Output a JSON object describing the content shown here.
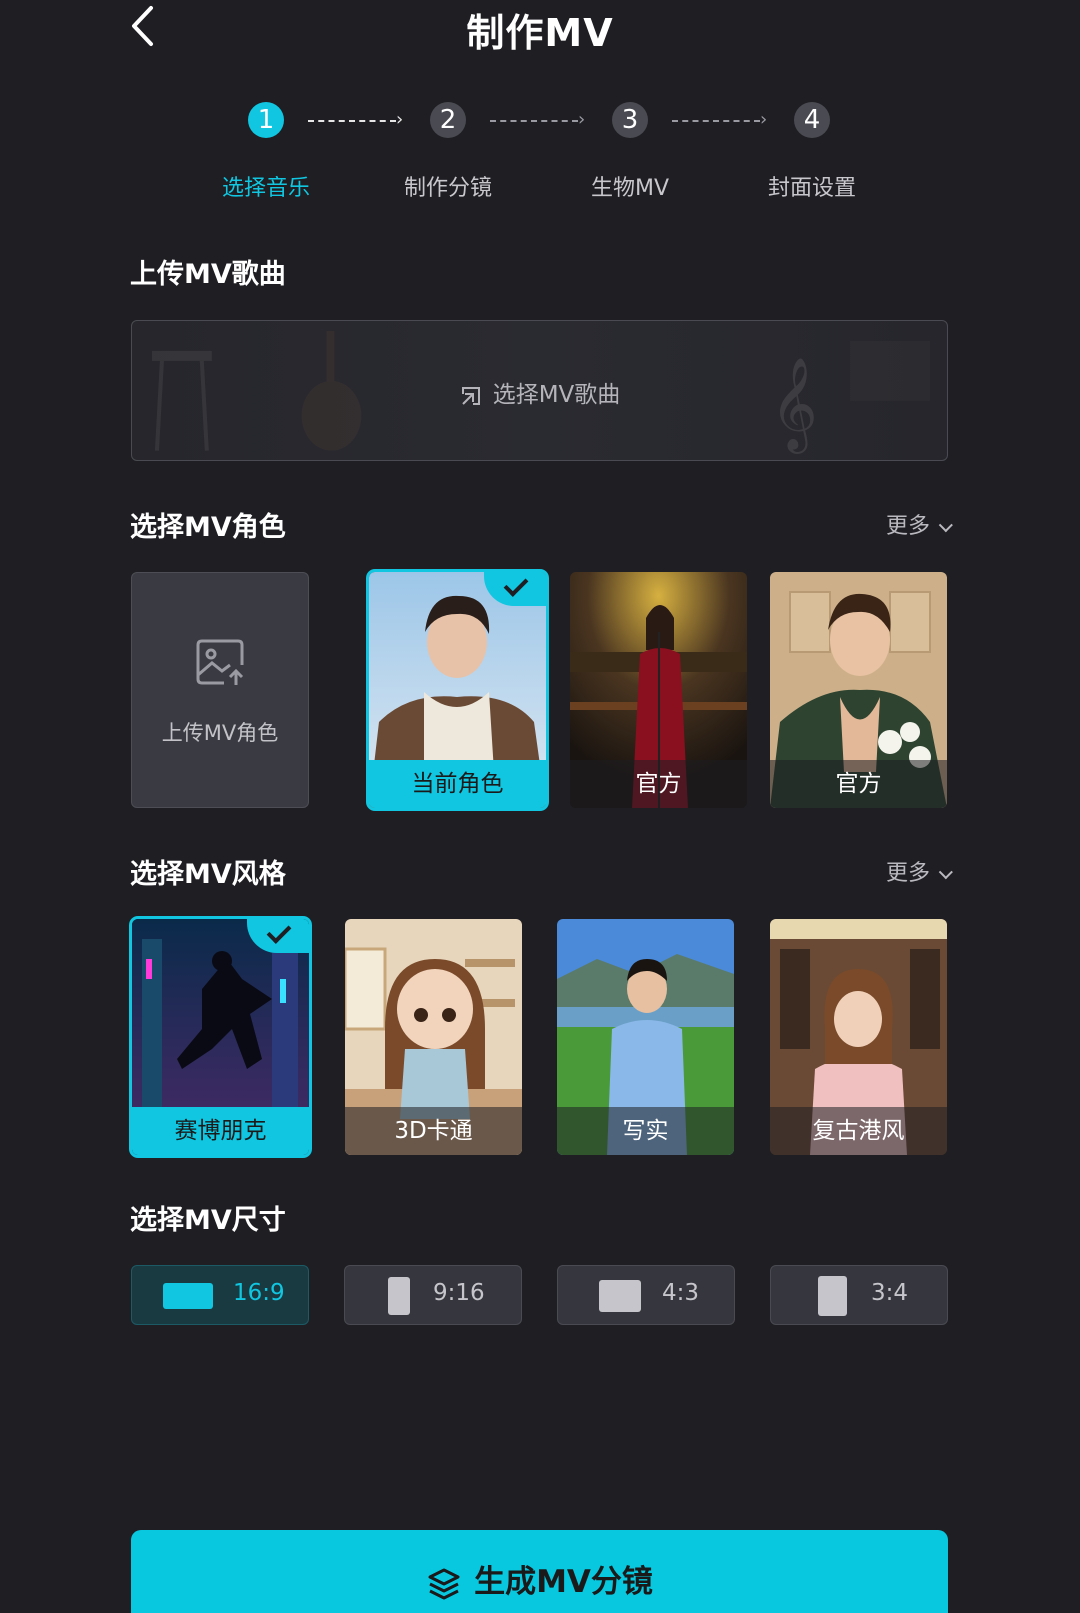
{
  "header": {
    "title": "制作MV"
  },
  "stepper": [
    {
      "number": "1",
      "label": "选择音乐",
      "active": true
    },
    {
      "number": "2",
      "label": "制作分镜",
      "active": false
    },
    {
      "number": "3",
      "label": "生物MV",
      "active": false
    },
    {
      "number": "4",
      "label": "封面设置",
      "active": false
    }
  ],
  "song_section": {
    "title": "上传MV歌曲",
    "button_label": "选择MV歌曲"
  },
  "role_section": {
    "title": "选择MV角色",
    "more_label": "更多",
    "upload_label": "上传MV角色",
    "cards": [
      {
        "label": "当前角色",
        "selected": true
      },
      {
        "label": "官方",
        "selected": false
      },
      {
        "label": "官方",
        "selected": false
      }
    ]
  },
  "style_section": {
    "title": "选择MV风格",
    "more_label": "更多",
    "cards": [
      {
        "label": "赛博朋克",
        "selected": true
      },
      {
        "label": "3D卡通",
        "selected": false
      },
      {
        "label": "写实",
        "selected": false
      },
      {
        "label": "复古港风",
        "selected": false
      }
    ]
  },
  "size_section": {
    "title": "选择MV尺寸",
    "options": [
      {
        "label": "16:9",
        "selected": true
      },
      {
        "label": "9:16",
        "selected": false
      },
      {
        "label": "4:3",
        "selected": false
      },
      {
        "label": "3:4",
        "selected": false
      }
    ]
  },
  "cta": {
    "label": "生成MV分镜"
  },
  "colors": {
    "accent": "#10c6e0",
    "background": "#1e1e23",
    "card": "#36363e"
  }
}
